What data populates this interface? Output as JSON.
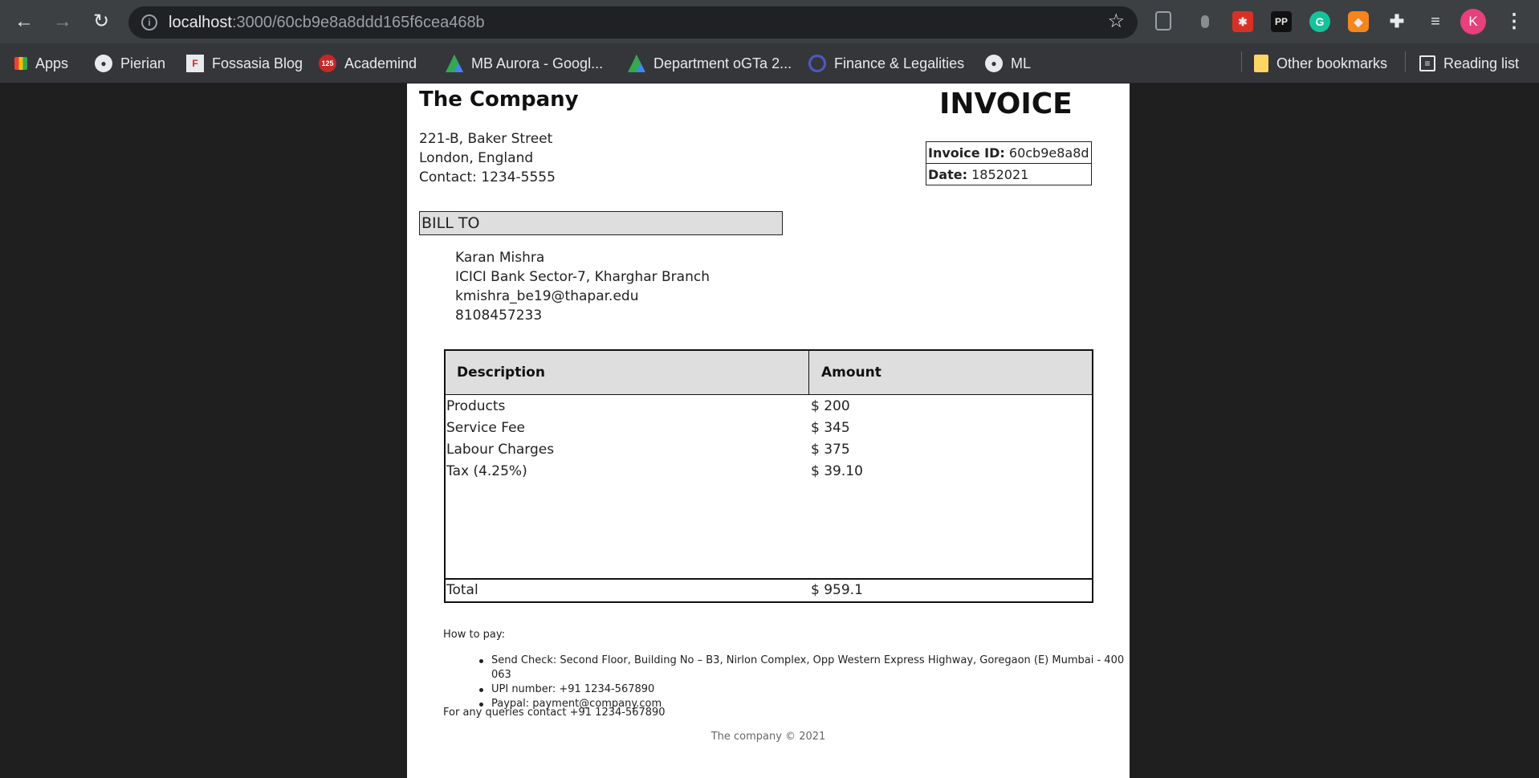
{
  "browser": {
    "url_host": "localhost",
    "url_path": ":3000/60cb9e8a8ddd165f6cea468b",
    "avatar_initial": "K",
    "bookmarks": [
      {
        "label": "Apps",
        "icon": "apps-grid-icon"
      },
      {
        "label": "Pierian",
        "icon": "github-icon"
      },
      {
        "label": "Fossasia Blog",
        "icon": "fossasia-icon"
      },
      {
        "label": "Academind",
        "icon": "academind-icon"
      },
      {
        "label": "MB Aurora - Googl...",
        "icon": "google-drive-icon"
      },
      {
        "label": "Department oGTa 2...",
        "icon": "google-drive-icon"
      },
      {
        "label": "Finance & Legalities",
        "icon": "link-icon"
      },
      {
        "label": "ML",
        "icon": "github-icon"
      }
    ],
    "other_bookmarks": "Other bookmarks",
    "reading_list": "Reading list",
    "extensions": [
      "clipboard-icon",
      "cursor-icon",
      "ladybug-icon",
      "pp-icon",
      "grammarly-icon",
      "metamask-icon",
      "puzzle-icon",
      "media-icon"
    ],
    "extension_pp_label": "PP",
    "extension_grammarly_label": "G"
  },
  "invoice": {
    "company": "The Company",
    "address": [
      "221-B, Baker Street",
      "London, England",
      "Contact: 1234-5555"
    ],
    "title": "INVOICE",
    "invoice_id_label": "Invoice ID:",
    "invoice_id": "60cb9e8a8d",
    "date_label": "Date:",
    "date": "1852021",
    "bill_to_label": "BILL TO",
    "client": [
      "Karan Mishra",
      "ICICI Bank Sector-7, Kharghar Branch",
      "kmishra_be19@thapar.edu",
      "8108457233"
    ],
    "table": {
      "headers": [
        "Description",
        "Amount"
      ],
      "rows": [
        {
          "description": "Products",
          "amount": "$ 200"
        },
        {
          "description": "Service Fee",
          "amount": "$ 345"
        },
        {
          "description": "Labour Charges",
          "amount": "$ 375"
        },
        {
          "description": "Tax (4.25%)",
          "amount": "$ 39.10"
        }
      ],
      "total_label": "Total",
      "total_amount": "$ 959.1"
    },
    "how_to_pay": "How to pay:",
    "payment_methods": [
      "Send Check: Second Floor, Building No – B3, Nirlon Complex, Opp Western Express Highway, Goregaon (E) Mumbai - 400 063",
      "UPI number: +91 1234-567890",
      "Paypal: payment@company.com"
    ],
    "queries": "For any queries contact +91 1234-567890",
    "footer": "The company © 2021"
  }
}
